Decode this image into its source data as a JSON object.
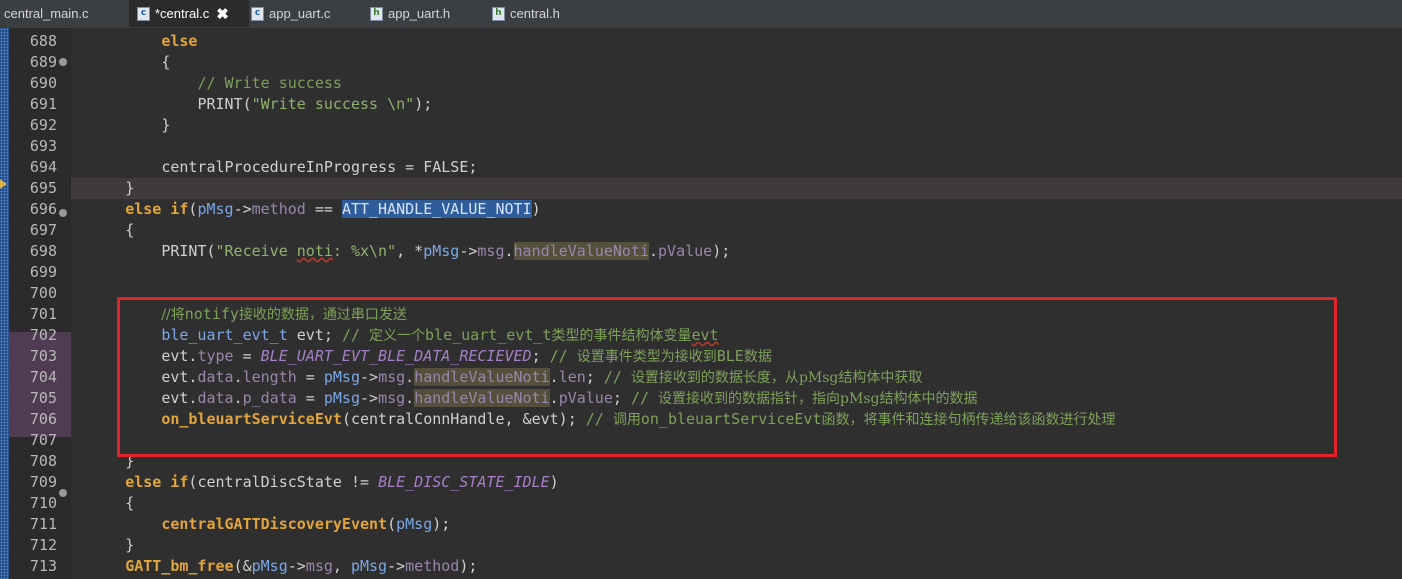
{
  "tabs": [
    {
      "label": "central_main.c",
      "icon": "c-file-icon"
    },
    {
      "label": "*central.c",
      "icon": "c-file-icon",
      "active": true,
      "close": "✖"
    },
    {
      "label": "app_uart.c",
      "icon": "c-file-icon"
    },
    {
      "label": "app_uart.h",
      "icon": "h-file-icon"
    },
    {
      "label": "central.h",
      "icon": "h-file-icon"
    }
  ],
  "file_icon_letters": {
    "c": "c",
    "h": "h"
  },
  "line_numbers": [
    "688",
    "689",
    "690",
    "691",
    "692",
    "693",
    "694",
    "695",
    "696",
    "697",
    "698",
    "699",
    "700",
    "701",
    "702",
    "703",
    "704",
    "705",
    "706",
    "707",
    "708",
    "709",
    "710",
    "711",
    "712",
    "713"
  ],
  "code": {
    "l688": {
      "kw": "else"
    },
    "l689": {
      "t": "{"
    },
    "l690": {
      "cmt": "// Write success"
    },
    "l691": {
      "fn": "PRINT",
      "open": "(",
      "str": "\"Write success \\n\"",
      "close": ");"
    },
    "l692": {
      "t": "}"
    },
    "l694": {
      "var": "centralProcedureInProgress",
      "op": " = ",
      "val": "FALSE",
      "end": ";"
    },
    "l695": {
      "t": "}"
    },
    "l696": {
      "kw_else": "else",
      "kw_if": "if",
      "open": "(",
      "var": "pMsg",
      "arrow": "->",
      "mem": "method",
      "op": " == ",
      "sel": "ATT_HANDLE_VALUE_NOTI",
      "close": ")"
    },
    "l697": {
      "t": "{"
    },
    "l698": {
      "fn": "PRINT",
      "open": "(",
      "str1": "\"Receive ",
      "str2": "noti",
      "str3": ": %x\\n\"",
      "comma": ", *",
      "var": "pMsg",
      "arrow": "->",
      "mem1": "msg",
      "dot1": ".",
      "occ": "handleValueNoti",
      "dot2": ".",
      "mem2": "pValue",
      "close": ");"
    },
    "l701": {
      "cmt_a": "//将",
      "cmt_b": "notify",
      "cmt_c": "接收的数据，通过串口发送"
    },
    "l702": {
      "type": "ble_uart_evt_t",
      "v": " evt; ",
      "cmt_a": "// ",
      "cmt_b": "定义一个",
      "cmt_c": "ble_uart_evt_t",
      "cmt_d": "类型的事件结构体变量",
      "cmt_e": "evt"
    },
    "l703": {
      "a": "evt.",
      "mem": "type",
      "op": " = ",
      "con": "BLE_UART_EVT_BLE_DATA_RECIEVED",
      "end": "; ",
      "cmt_a": "// ",
      "cmt_b": "设置事件类型为接收到",
      "cmt_c": "BLE",
      "cmt_d": "数据"
    },
    "l704": {
      "a": "evt.",
      "mem1": "data",
      "dot": ".",
      "mem2": "length",
      "op": " = ",
      "var": "pMsg",
      "arrow": "->",
      "mem3": "msg",
      "dot2": ".",
      "occ": "handleValueNoti",
      "dot3": ".",
      "mem4": "len",
      "end": "; ",
      "cmt_a": "// ",
      "cmt_b": "设置接收到的数据长度，从",
      "cmt_c": "pMsg",
      "cmt_d": "结构体中获取"
    },
    "l705": {
      "a": "evt.",
      "mem1": "data",
      "dot": ".",
      "mem2": "p_data",
      "op": " = ",
      "var": "pMsg",
      "arrow": "->",
      "mem3": "msg",
      "dot2": ".",
      "occ": "handleValueNoti",
      "dot3": ".",
      "mem4": "pValue",
      "end": "; ",
      "cmt_a": "// ",
      "cmt_b": "设置接收到的数据指针，指向",
      "cmt_c": "pMsg",
      "cmt_d": "结构体中的数据"
    },
    "l706": {
      "fn": "on_bleuartServiceEvt",
      "args": "(centralConnHandle, &evt); ",
      "cmt_a": "// ",
      "cmt_b": "调用",
      "cmt_c": "on_bleuartServiceEvt",
      "cmt_d": "函数，将事件和连接句柄传递给该函数进行处理"
    },
    "l708": {
      "t": "}"
    },
    "l709": {
      "kw_else": "else",
      "kw_if": "if",
      "open": "(",
      "var": "centralDiscState",
      "op": " != ",
      "con": "BLE_DISC_STATE_IDLE",
      "close": ")"
    },
    "l710": {
      "t": "{"
    },
    "l711": {
      "fn": "centralGATTDiscoveryEvent",
      "open": "(",
      "var": "pMsg",
      "close": ");"
    },
    "l712": {
      "t": "}"
    },
    "l713": {
      "fn": "GATT_bm_free",
      "open": "(&",
      "var1": "pMsg",
      "arrow1": "->",
      "mem": "msg",
      "comma": ", ",
      "var2": "pMsg",
      "arrow2": "->",
      "mem2": "method",
      "close": ");"
    }
  },
  "colors": {
    "highlight_box": "#e0242a",
    "selection": "#2f5c9a",
    "keyword": "#e2a43c"
  }
}
